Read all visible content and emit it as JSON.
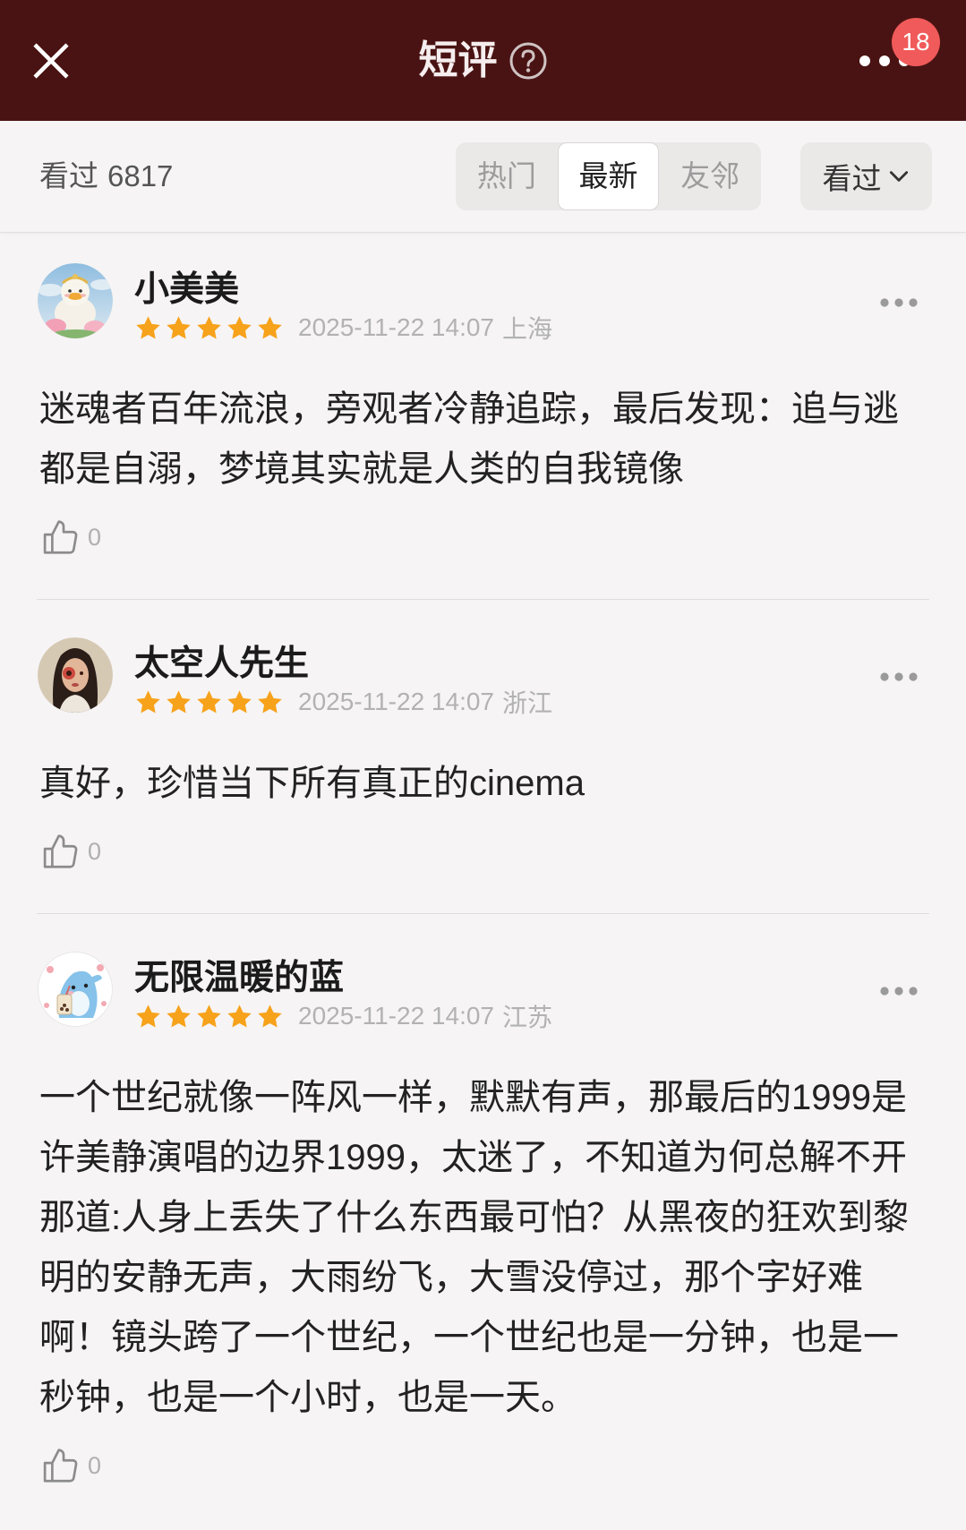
{
  "colors": {
    "header_bg": "#4a1313",
    "badge": "#f05a5a",
    "star": "#f7a21b"
  },
  "header": {
    "title": "短评",
    "badge": "18",
    "icons": {
      "close": "close-icon",
      "help": "question-circle-icon",
      "more": "more-dots-icon"
    }
  },
  "filter": {
    "watched_label": "看过",
    "watched_count": "6817",
    "tabs": [
      {
        "label": "热门",
        "selected": false
      },
      {
        "label": "最新",
        "selected": true
      },
      {
        "label": "友邻",
        "selected": false
      }
    ],
    "dropdown": {
      "label": "看过",
      "icon": "chevron-down-icon"
    }
  },
  "reviews": [
    {
      "name": "小美美",
      "rating": 5,
      "date": "2025-11-22 14:07",
      "location": "上海",
      "text": "迷魂者百年流浪，旁观者冷静追踪，最后发现：追与逃都是自溺，梦境其实就是人类的自我镜像",
      "likes": "0"
    },
    {
      "name": "太空人先生",
      "rating": 5,
      "date": "2025-11-22 14:07",
      "location": "浙江",
      "text": "真好，珍惜当下所有真正的cinema",
      "likes": "0"
    },
    {
      "name": "无限温暖的蓝",
      "rating": 5,
      "date": "2025-11-22 14:07",
      "location": "江苏",
      "text": "一个世纪就像一阵风一样，默默有声，那最后的1999是许美静演唱的边界1999，太迷了，不知道为何总解不开那道:人身上丢失了什么东西最可怕？从黑夜的狂欢到黎明的安静无声，大雨纷飞，大雪没停过，那个字好难啊！镜头跨了一个世纪，一个世纪也是一分钟，也是一秒钟，也是一个小时，也是一天。",
      "likes": "0"
    }
  ]
}
